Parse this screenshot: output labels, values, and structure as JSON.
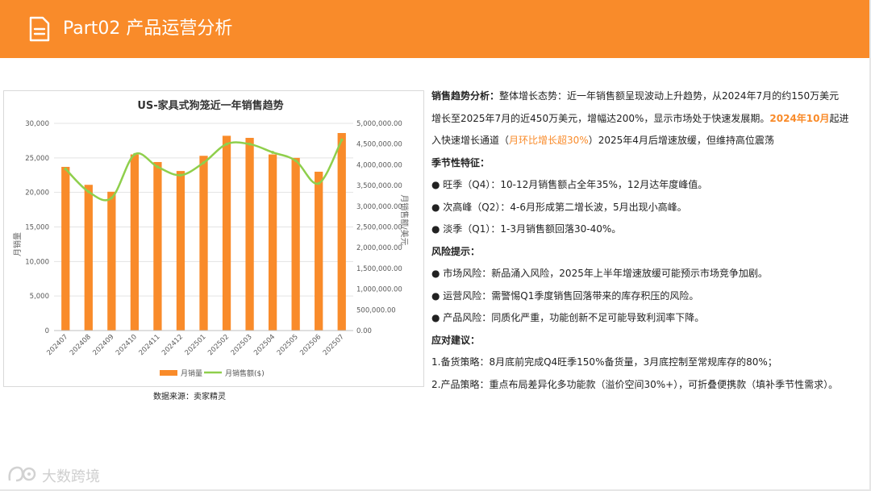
{
  "header": {
    "title": "Part02 产品运营分析",
    "bg_color": "#f98b2a",
    "icon": "document-icon"
  },
  "chart_data": {
    "type": "bar-line-combo",
    "title": "US-家具式狗笼近一年销售趋势",
    "ylabel_left": "月销量",
    "ylabel_right": "月销售额/美元",
    "categories": [
      "202407",
      "202408",
      "202409",
      "202410",
      "202411",
      "202412",
      "202501",
      "202502",
      "202503",
      "202504",
      "202505",
      "202506",
      "202507"
    ],
    "series": [
      {
        "name": "月销量",
        "type": "bar",
        "axis": "left",
        "color": "#f98b2a",
        "values": [
          23700,
          21100,
          20100,
          25500,
          24400,
          23100,
          25300,
          28200,
          27900,
          25500,
          25000,
          23000,
          28600
        ]
      },
      {
        "name": "月销售额($)",
        "type": "line",
        "axis": "right",
        "color": "#8fcf4c",
        "values": [
          3900000,
          3350000,
          3200000,
          4250000,
          3950000,
          3750000,
          4050000,
          4500000,
          4500000,
          4300000,
          4100000,
          3550000,
          4600000
        ]
      }
    ],
    "ylim_left": [
      0,
      30000
    ],
    "ylim_right": [
      0,
      5000000
    ],
    "yticks_left": [
      "0",
      "5,000",
      "10,000",
      "15,000",
      "20,000",
      "25,000",
      "30,000"
    ],
    "yticks_right": [
      "0.00",
      "500,000.00",
      "1,000,000.00",
      "1,500,000.00",
      "2,000,000.00",
      "2,500,000.00",
      "3,000,000.00",
      "3,500,000.00",
      "4,000,000.00",
      "4,500,000.00",
      "5,000,000.00"
    ],
    "legend_position": "bottom",
    "grid": true
  },
  "source_label": "数据来源：卖家精灵",
  "analysis": {
    "trend_head": "销售趋势分析：",
    "trend_text_1": "整体增长态势：近一年销售额呈现波动上升趋势，从2024年7月的约150万美元",
    "trend_text_2": "增长至2025年7月的近450万美元，增幅达200%，显示市场处于快速发展期。",
    "trend_highlight": "2024年10月",
    "trend_text_3": "起进",
    "trend_text_4": "入快速增长通道（",
    "trend_highlight_2": "月环比增长超30%",
    "trend_text_5": "）2025年4月后增速放缓，但维持高位震荡",
    "season_head": "季节性特征：",
    "season_items": [
      "旺季（Q4）：10-12月销售额占全年35%，12月达年度峰值。",
      "次高峰（Q2）：4-6月形成第二增长波，5月出现小高峰。",
      "淡季（Q1）：1-3月销售额回落30-40%。"
    ],
    "risk_head": "风险提示：",
    "risk_items": [
      "市场风险：新品涌入风险，2025年上半年增速放缓可能预示市场竞争加剧。",
      "运营风险：需警惕Q1季度销售回落带来的库存积压的风险。",
      "产品风险：同质化严重，功能创新不足可能导致利润率下降。"
    ],
    "advice_head": "应对建议：",
    "advice_items": [
      "1.备货策略：8月底前完成Q4旺季150%备货量，3月底控制至常规库存的80%；",
      "2.产品策略：重点布局差异化多功能款（溢价空间30%+），可折叠便携款（填补季节性需求）。"
    ]
  },
  "logo": {
    "text": "大数跨境",
    "icon": "brand-logo-icon"
  }
}
